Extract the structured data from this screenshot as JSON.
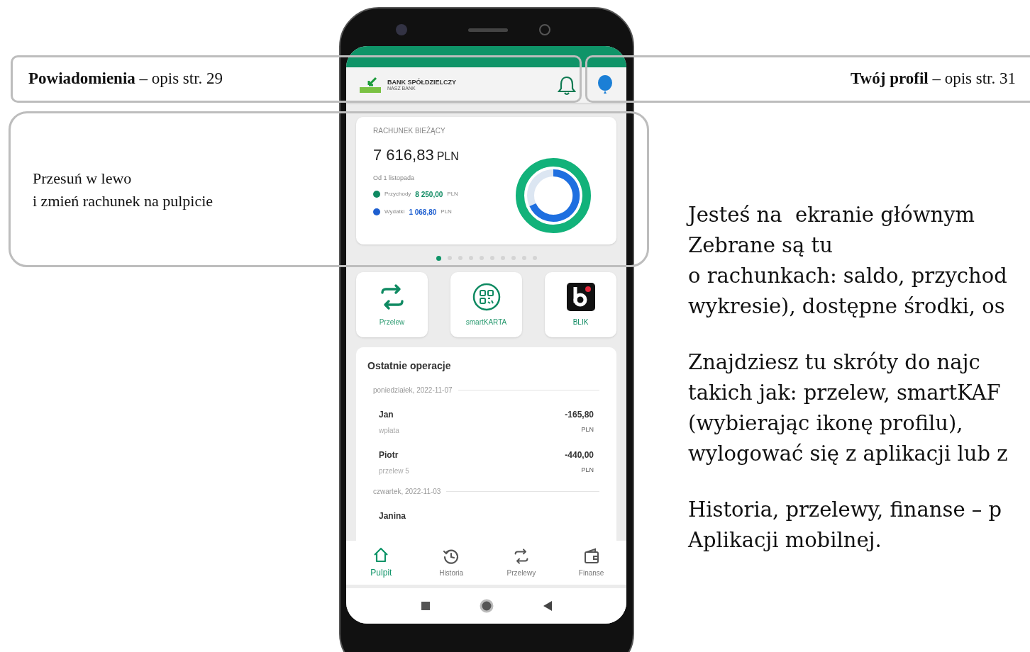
{
  "callouts": [
    {
      "bold": "Powiadomienia",
      "rest": " – opis str. 29"
    },
    {
      "bold": "Twój profil",
      "rest": " – opis str. 31"
    }
  ],
  "swipe_note": [
    "Przesuń w lewo",
    "i zmień rachunek na pulpicie"
  ],
  "description": [
    [
      "Jesteś na  ekranie głównym",
      "Zebrane są tu",
      "o rachunkach: saldo, przychod",
      "wykresie), dostępne środki, os"
    ],
    [
      "Znajdziesz tu skróty do najc",
      "takich jak: przelew, smartKAF",
      "(wybierając ikonę profilu),",
      "wylogować się z aplikacji lub z"
    ],
    [
      "Historia, przelewy, finanse – p",
      "Aplikacji mobilnej."
    ]
  ],
  "app": {
    "bank_name": "BANK SPÓŁDZIELCZY",
    "bank_sub": "NASZ BANK",
    "account": {
      "label": "RACHUNEK BIEŻĄCY",
      "amount": "7 616,83",
      "currency": "PLN",
      "since": "Od 1 listopada",
      "legend": [
        {
          "label": "Przychody",
          "value": "8 250,00",
          "currency": "PLN",
          "color": "#0f8a62"
        },
        {
          "label": "Wydatki",
          "value": "1 068,80",
          "currency": "PLN",
          "color": "#1e5fd0"
        }
      ]
    },
    "page_dots": [
      {
        "selected": true
      },
      {
        "selected": false
      },
      {
        "selected": false
      },
      {
        "selected": false
      },
      {
        "selected": false
      },
      {
        "selected": false
      },
      {
        "selected": false
      },
      {
        "selected": false
      },
      {
        "selected": false
      },
      {
        "selected": false
      }
    ],
    "shortcuts": [
      {
        "kind": "transfer",
        "label": "Przelew"
      },
      {
        "kind": "qr",
        "label": "smartKARTA"
      },
      {
        "kind": "blik",
        "label": "BLIK"
      }
    ],
    "operations": {
      "title": "Ostatnie operacje",
      "groups": [
        {
          "date": "poniedziałek, 2022-11-07",
          "items": [
            {
              "name": "Jan",
              "detail": "wpłata",
              "amount": "-165,80",
              "currency": "PLN"
            },
            {
              "name": "Piotr",
              "detail": "przelew 5",
              "amount": "-440,00",
              "currency": "PLN"
            }
          ]
        },
        {
          "date": "czwartek, 2022-11-03",
          "items": [
            {
              "name": "Janina"
            }
          ]
        }
      ]
    },
    "nav": [
      {
        "kind": "home",
        "label": "Pulpit",
        "selected": true
      },
      {
        "kind": "history",
        "label": "Historia",
        "selected": false
      },
      {
        "kind": "transfer",
        "label": "Przelewy",
        "selected": false
      },
      {
        "kind": "wallet",
        "label": "Finanse",
        "selected": false
      }
    ]
  }
}
